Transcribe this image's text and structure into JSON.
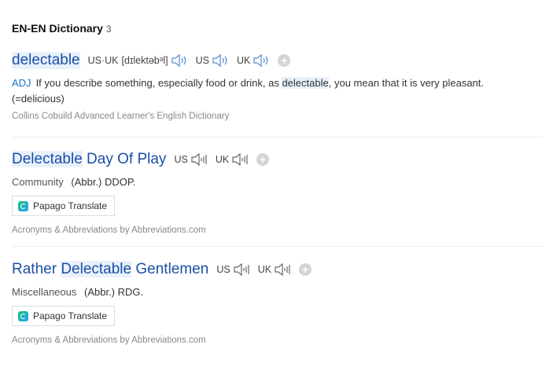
{
  "header": {
    "title": "EN-EN Dictionary",
    "count": "3"
  },
  "entries": [
    {
      "headword": "delectable",
      "pron_label": "US·UK",
      "ipa": "[dɪlektəbᵊl]",
      "loc_us": "US",
      "loc_uk": "UK",
      "pos": "ADJ",
      "def_a": "If you describe something, especially food or drink, as ",
      "def_hl": "delectable",
      "def_b": ", you mean that it is very pleasant. (=delicious)",
      "source": "Collins Cobuild Advanced Learner's English Dictionary"
    },
    {
      "hw_hl": "Delectable",
      "hw_rest": " Day Of Play",
      "loc_us": "US",
      "loc_uk": "UK",
      "category": "Community",
      "abbr": "(Abbr.) DDOP.",
      "papago": "Papago Translate",
      "source": "Acronyms & Abbreviations by Abbreviations.com"
    },
    {
      "hw_pre": "Rather ",
      "hw_hl": "Delectable",
      "hw_rest": " Gentlemen",
      "loc_us": "US",
      "loc_uk": "UK",
      "category": "Miscellaneous",
      "abbr": "(Abbr.) RDG.",
      "papago": "Papago Translate",
      "source": "Acronyms & Abbreviations by Abbreviations.com"
    }
  ],
  "colors": {
    "link": "#1a4fa8",
    "highlight": "#e8f1fb",
    "pos": "#1a73c8"
  },
  "icons": {
    "speaker": "speaker-icon",
    "add": "plus-circle-icon",
    "papago": "papago-logo-icon"
  }
}
